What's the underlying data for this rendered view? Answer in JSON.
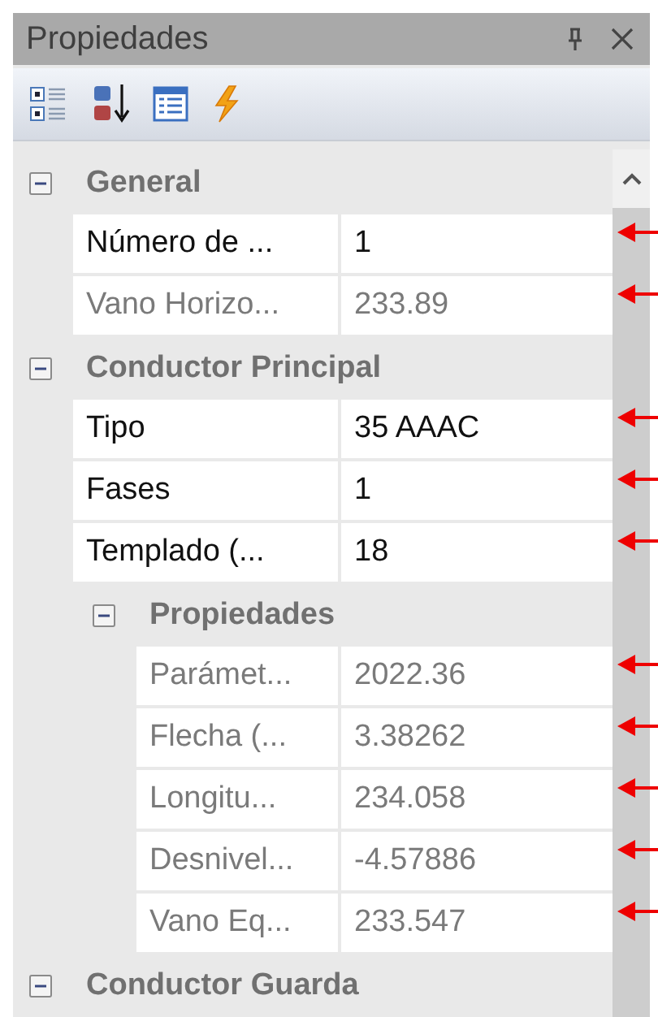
{
  "window": {
    "title": "Propiedades"
  },
  "grid": [
    {
      "kind": "category",
      "label": "General",
      "expanded": true,
      "children": [
        {
          "kind": "property",
          "name": "Número de ...",
          "value": "1",
          "readonly": false,
          "marked": true
        },
        {
          "kind": "property",
          "name": "Vano Horizo...",
          "value": "233.89",
          "readonly": true,
          "marked": true
        }
      ]
    },
    {
      "kind": "category",
      "label": "Conductor Principal",
      "expanded": true,
      "children": [
        {
          "kind": "property",
          "name": "Tipo",
          "value": "35 AAAC",
          "readonly": false,
          "marked": true
        },
        {
          "kind": "property",
          "name": "Fases",
          "value": "1",
          "readonly": false,
          "marked": true
        },
        {
          "kind": "property",
          "name": "Templado (...",
          "value": "18",
          "readonly": false,
          "marked": true
        },
        {
          "kind": "category",
          "label": "Propiedades",
          "expanded": true,
          "children": [
            {
              "kind": "property",
              "name": "Parámet...",
              "value": "2022.36",
              "readonly": true,
              "marked": true
            },
            {
              "kind": "property",
              "name": "Flecha (...",
              "value": "3.38262",
              "readonly": true,
              "marked": true
            },
            {
              "kind": "property",
              "name": "Longitu...",
              "value": "234.058",
              "readonly": true,
              "marked": true
            },
            {
              "kind": "property",
              "name": "Desnivel...",
              "value": "-4.57886",
              "readonly": true,
              "marked": true
            },
            {
              "kind": "property",
              "name": "Vano Eq...",
              "value": "233.547",
              "readonly": true,
              "marked": true
            }
          ]
        }
      ]
    },
    {
      "kind": "category",
      "label": "Conductor Guarda",
      "expanded": true
    }
  ]
}
